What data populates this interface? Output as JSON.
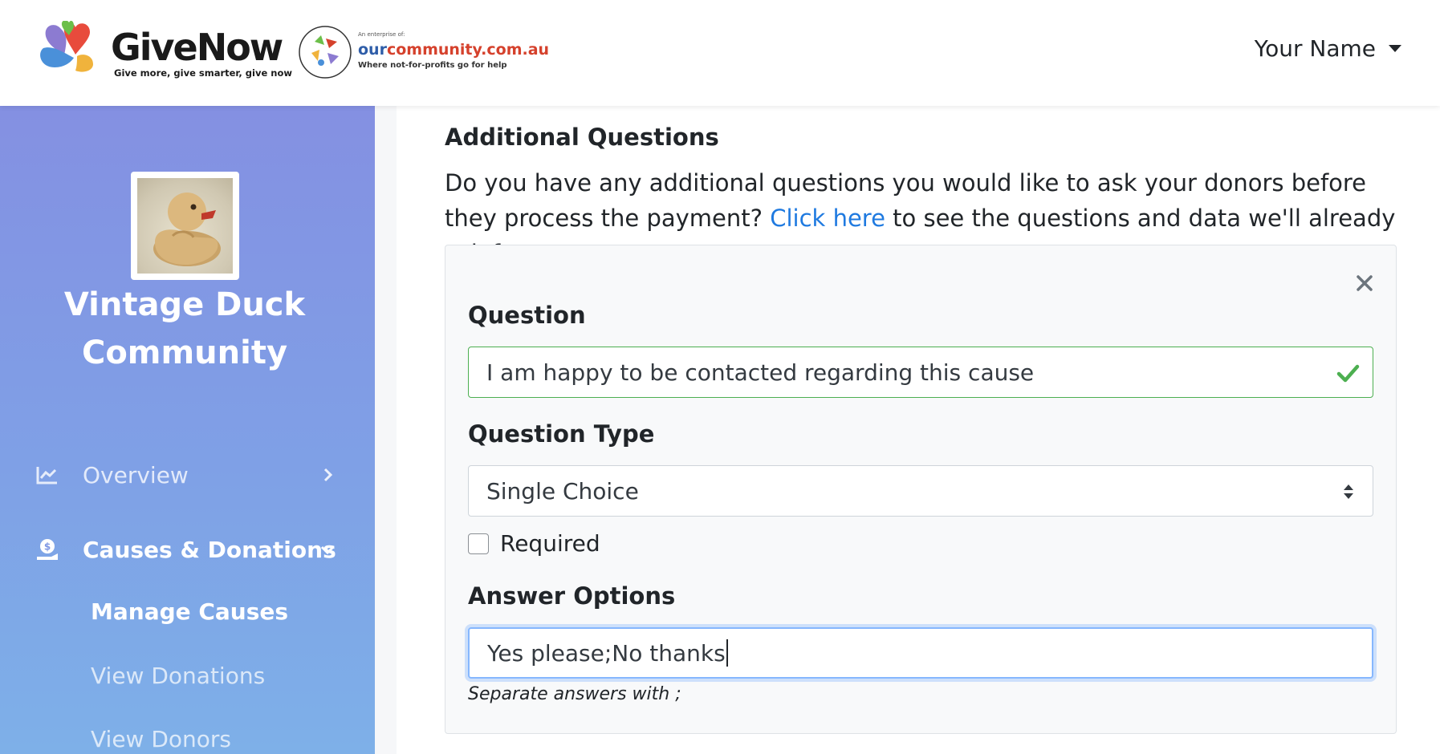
{
  "header": {
    "brand_name": "GiveNow",
    "brand_tagline": "Give more, give smarter, give now",
    "partner_small": "An enterprise of:",
    "partner_name_prefix": "our",
    "partner_name_main": "community.com.au",
    "partner_tagline": "Where not-for-profits go for help",
    "user_name": "Your Name"
  },
  "sidebar": {
    "org_name": "Vintage Duck Community",
    "nav": [
      {
        "label": "Overview",
        "icon": "chart-line-icon",
        "active": false
      },
      {
        "label": "Causes & Donations",
        "icon": "donate-hand-icon",
        "active": true
      }
    ],
    "sub_nav": [
      {
        "label": "Manage Causes",
        "active": true
      },
      {
        "label": "View Donations",
        "active": false
      },
      {
        "label": "View Donors",
        "active": false
      }
    ]
  },
  "main": {
    "section_title": "Additional Questions",
    "desc_before": "Do you have any additional questions you would like to ask your donors before they process the payment? ",
    "desc_link": "Click here",
    "desc_after": " to see the questions and data we'll already ask for you.",
    "question_card": {
      "question_label": "Question",
      "question_value": "I am happy to be contacted regarding this cause",
      "type_label": "Question Type",
      "type_value": "Single Choice",
      "required_label": "Required",
      "required_checked": false,
      "answers_label": "Answer Options",
      "answers_value": "Yes please;No thanks",
      "answers_help": "Separate answers with ;"
    }
  },
  "colors": {
    "link": "#1f7ae0",
    "valid": "#4caf50",
    "sidebar_top": "#8490e2",
    "sidebar_bottom": "#7eb0e8"
  }
}
